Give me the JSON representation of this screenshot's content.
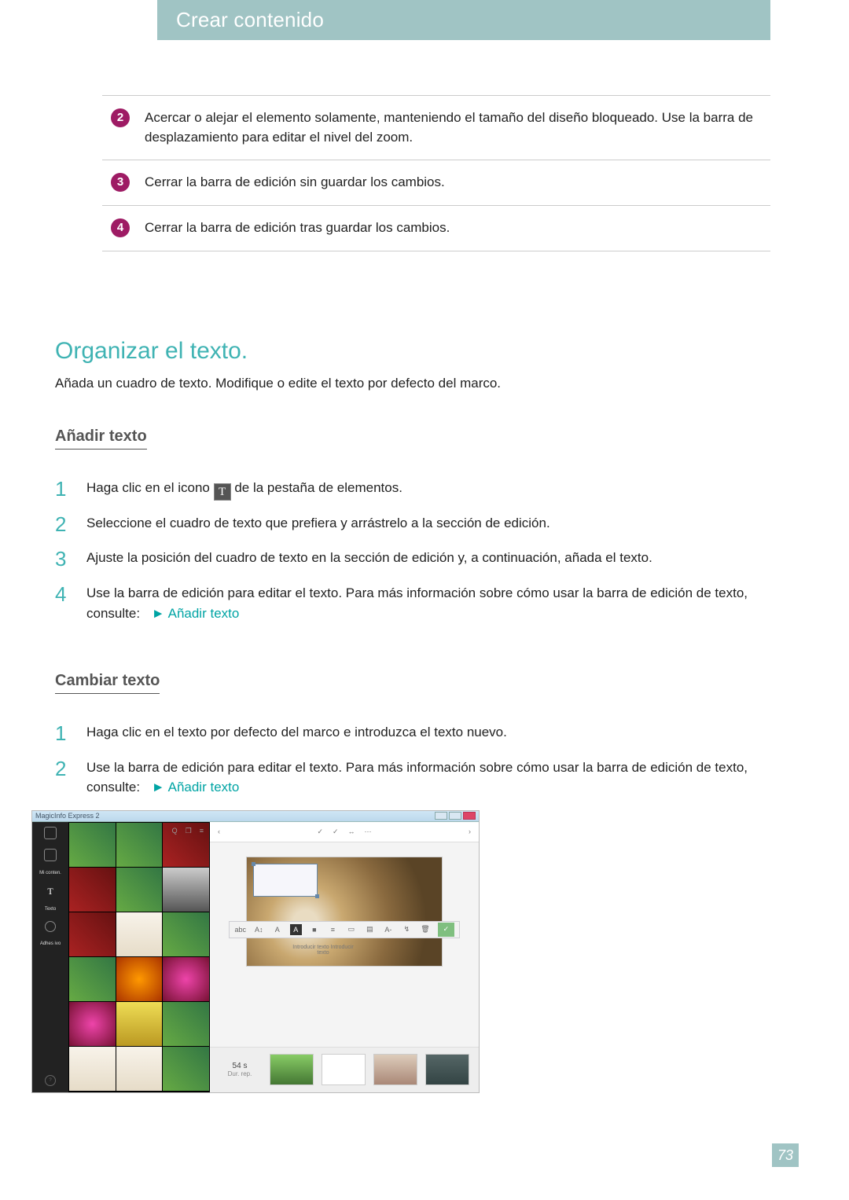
{
  "banner": "Crear contenido",
  "defs": [
    {
      "n": "2",
      "text": "Acercar o alejar el elemento solamente, manteniendo el tamaño del diseño bloqueado. Use la barra de desplazamiento para editar el nivel del zoom."
    },
    {
      "n": "3",
      "text": "Cerrar la barra de edición sin guardar los cambios."
    },
    {
      "n": "4",
      "text": "Cerrar la barra de edición tras guardar los cambios."
    }
  ],
  "h2": "Organizar el texto.",
  "intro": "Añada un cuadro de texto. Modifique o edite el texto por defecto del marco.",
  "add": {
    "heading": "Añadir texto",
    "steps": [
      {
        "pre": "Haga clic en el icono ",
        "post": " de la pestaña de elementos.",
        "icon": "T"
      },
      {
        "text": "Seleccione el cuadro de texto que prefiera y arrástrelo a la sección de edición."
      },
      {
        "text": "Ajuste la posición del cuadro de texto en la sección de edición y, a continuación, añada el texto."
      },
      {
        "text": "Use la barra de edición para editar el texto. Para más información sobre cómo usar la barra de edición de texto, consulte:",
        "link": "Añadir texto"
      }
    ]
  },
  "change": {
    "heading": "Cambiar texto",
    "steps": [
      {
        "text": "Haga clic en el texto por defecto del marco e introduzca el texto nuevo."
      },
      {
        "text": "Use la barra de edición para editar el texto. Para más información sobre cómo usar la barra de edición de texto, consulte:",
        "link": "Añadir texto"
      }
    ]
  },
  "screenshot": {
    "app_title": "MagicInfo Express 2",
    "rail": {
      "mycontent": "Mi conten.",
      "texto": "Texto",
      "adhesivo": "Adhes ivo"
    },
    "thumb_bar_icons": [
      "Q",
      "❐",
      "≡"
    ],
    "topbar": {
      "left": "‹",
      "right": "›",
      "mid": [
        "✓",
        "✓",
        "↔",
        "⋯"
      ]
    },
    "toolbar": {
      "items": [
        "abc",
        "A↕",
        "A",
        "A",
        "■",
        "≡",
        "▭",
        "▤",
        "A-",
        "↯",
        "🗑"
      ],
      "confirm": "✓"
    },
    "caption": "Introducir texto\nIntroducir texto",
    "strip": {
      "time": "54 s",
      "sub": "Dur. rep."
    }
  },
  "page_number": "73",
  "link_arrow": "►"
}
